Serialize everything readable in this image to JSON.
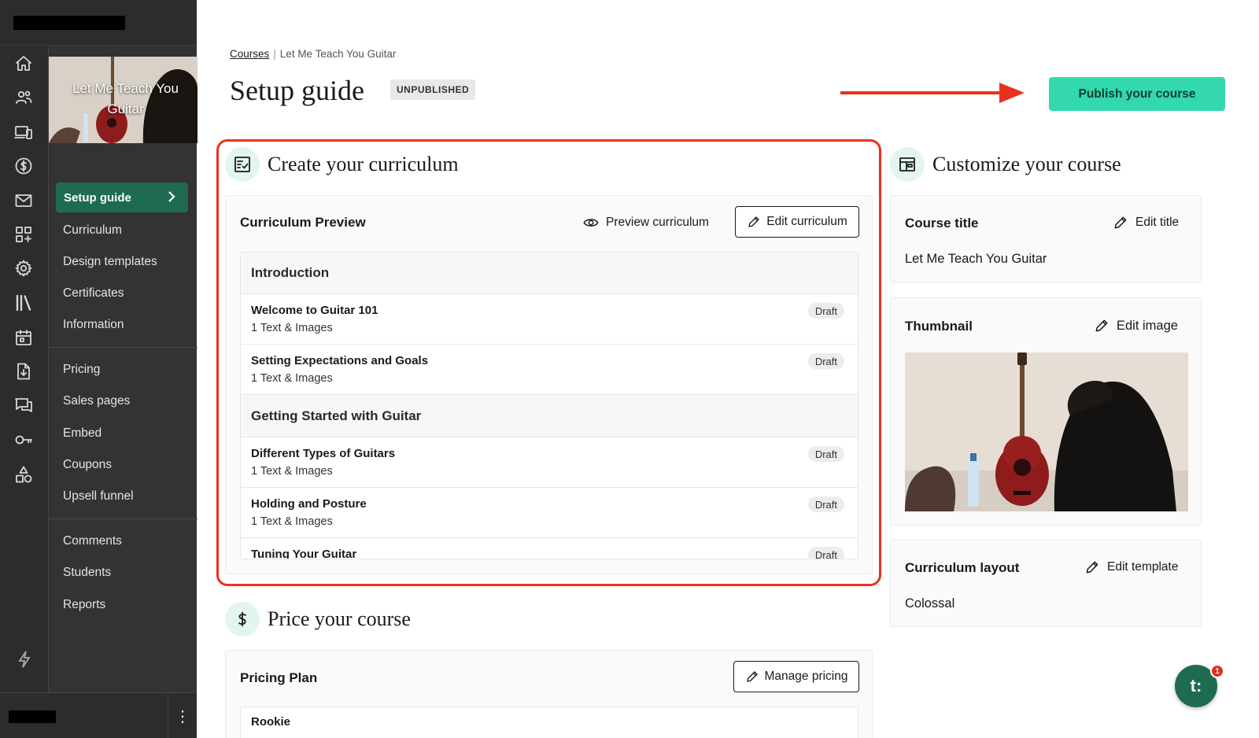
{
  "sidebar": {
    "course_title": "Let Me Teach You Guitar",
    "setup_label": "Setup guide",
    "nav_group_1": [
      "Curriculum",
      "Design templates",
      "Certificates",
      "Information"
    ],
    "nav_group_2": [
      "Pricing",
      "Sales pages",
      "Embed",
      "Coupons",
      "Upsell funnel"
    ],
    "nav_group_3": [
      "Comments",
      "Students",
      "Reports"
    ],
    "rail_icons": [
      "home-icon",
      "users-icon",
      "devices-icon",
      "dollar-icon",
      "mail-icon",
      "apps-icon",
      "gear-icon",
      "library-icon",
      "calendar-icon",
      "download-file-icon",
      "chat-icon",
      "key-icon",
      "shapes-icon"
    ],
    "kebab": "⋮"
  },
  "header": {
    "breadcrumb_root": "Courses",
    "breadcrumb_sep": "|",
    "breadcrumb_current": "Let Me Teach You Guitar",
    "title": "Setup guide",
    "status": "UNPUBLISHED",
    "publish_label": "Publish your course"
  },
  "curriculum": {
    "section_title": "Create your curriculum",
    "card_title": "Curriculum Preview",
    "preview_label": "Preview curriculum",
    "edit_label": "Edit curriculum",
    "chapters": [
      {
        "name": "Introduction",
        "lessons": [
          {
            "title": "Welcome to Guitar 101",
            "meta": "1 Text & Images",
            "status": "Draft"
          },
          {
            "title": "Setting Expectations and Goals",
            "meta": "1 Text & Images",
            "status": "Draft"
          }
        ]
      },
      {
        "name": "Getting Started with Guitar",
        "lessons": [
          {
            "title": "Different Types of Guitars",
            "meta": "1 Text & Images",
            "status": "Draft"
          },
          {
            "title": "Holding and Posture",
            "meta": "1 Text & Images",
            "status": "Draft"
          },
          {
            "title": "Tuning Your Guitar",
            "meta": "",
            "status": "Draft"
          }
        ]
      }
    ]
  },
  "pricing": {
    "section_title": "Price your course",
    "card_title": "Pricing Plan",
    "manage_label": "Manage pricing",
    "first_plan": "Rookie"
  },
  "customize": {
    "section_title": "Customize your course",
    "course_title_label": "Course title",
    "edit_title_label": "Edit title",
    "course_title_value": "Let Me Teach You Guitar",
    "thumbnail_label": "Thumbnail",
    "edit_image_label": "Edit image",
    "layout_label": "Curriculum layout",
    "edit_template_label": "Edit template",
    "layout_value": "Colossal"
  },
  "chat": {
    "label": "t:",
    "badge": "1"
  },
  "colors": {
    "accent": "#34d8ae",
    "nav_active": "#1f6b4f",
    "annotation": "#e8321f",
    "sidebar": "#333333"
  }
}
